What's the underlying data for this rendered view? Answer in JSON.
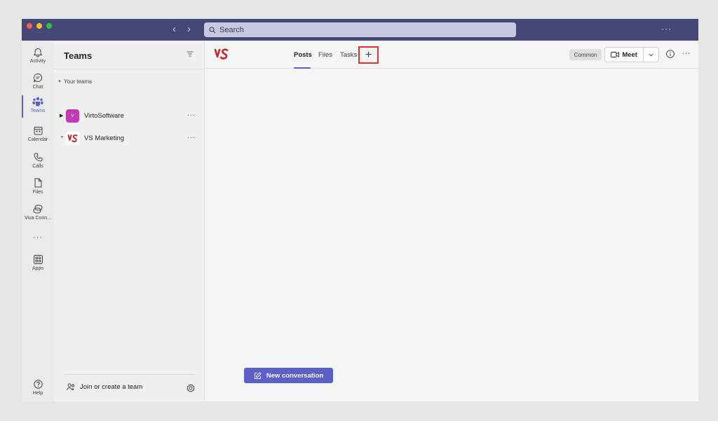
{
  "search": {
    "placeholder": "Search"
  },
  "rail": {
    "items": [
      {
        "label": "Activity"
      },
      {
        "label": "Chat"
      },
      {
        "label": "Teams"
      },
      {
        "label": "Calendar"
      },
      {
        "label": "Calls"
      },
      {
        "label": "Files"
      },
      {
        "label": "Viva Conn..."
      },
      {
        "label": "Apps"
      },
      {
        "label": "Help"
      }
    ]
  },
  "left_panel": {
    "title": "Teams",
    "section_label": "Your teams",
    "teams": [
      {
        "name": "VirtoSoftware",
        "avatar_letter": "V",
        "avatar_color": "#c239b3"
      },
      {
        "name": "VS Marketing"
      }
    ],
    "join_label": "Join or create a team"
  },
  "channel_header": {
    "tabs": [
      {
        "label": "Posts",
        "active": true
      },
      {
        "label": "Files",
        "active": false
      },
      {
        "label": "Tasks",
        "active": false
      }
    ],
    "add_tab_symbol": "+",
    "common_label": "Common",
    "meet_label": "Meet"
  },
  "main": {
    "new_conversation_label": "New conversation"
  },
  "colors": {
    "titlebar": "#464775",
    "accent": "#5b5fc7",
    "highlight_box": "#e0312b",
    "logo": "#c4262e"
  }
}
